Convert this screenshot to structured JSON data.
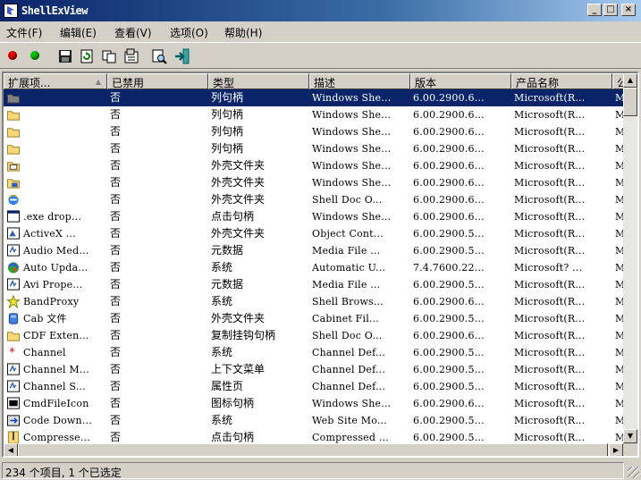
{
  "window": {
    "title": "ShellExView"
  },
  "titlebar_buttons": {
    "minimize": "_",
    "maximize": "□",
    "close": "×"
  },
  "menu": [
    "文件(F)",
    "编辑(E)",
    "查看(V)",
    "选项(O)",
    "帮助(H)"
  ],
  "toolbar_icons": [
    "red-dot-icon",
    "green-dot-icon",
    "save-icon",
    "refresh-icon",
    "copy-icon",
    "properties-icon",
    "find-icon",
    "exit-icon"
  ],
  "colors": {
    "selected": "#0a246a",
    "title_start": "#0a246a",
    "red_dot": "#e00000",
    "green_dot": "#00c000"
  },
  "columns": [
    "扩展项...",
    "已禁用",
    "类型",
    "描述",
    "版本",
    "产品名称",
    "公"
  ],
  "rows": [
    {
      "icon": "folder-gray-icon",
      "name": "",
      "disabled": "否",
      "type": "列句柄",
      "desc": "Windows She...",
      "version": "6.00.2900.6...",
      "product": "Microsoft(R...",
      "company": "M:",
      "selected": true
    },
    {
      "icon": "folder-icon",
      "name": "",
      "disabled": "否",
      "type": "列句柄",
      "desc": "Windows She...",
      "version": "6.00.2900.6...",
      "product": "Microsoft(R...",
      "company": "M:"
    },
    {
      "icon": "folder-icon",
      "name": "",
      "disabled": "否",
      "type": "列句柄",
      "desc": "Windows She...",
      "version": "6.00.2900.6...",
      "product": "Microsoft(R...",
      "company": "M:"
    },
    {
      "icon": "folder-icon",
      "name": "",
      "disabled": "否",
      "type": "列句柄",
      "desc": "Windows She...",
      "version": "6.00.2900.6...",
      "product": "Microsoft(R...",
      "company": "M:"
    },
    {
      "icon": "printer-folder-icon",
      "name": "",
      "disabled": "否",
      "type": "外壳文件夹",
      "desc": "Windows She...",
      "version": "6.00.2900.6...",
      "product": "Microsoft(R...",
      "company": "M:"
    },
    {
      "icon": "network-folder-icon",
      "name": "",
      "disabled": "否",
      "type": "外壳文件夹",
      "desc": "Windows She...",
      "version": "6.00.2900.6...",
      "product": "Microsoft(R...",
      "company": "M:"
    },
    {
      "icon": "ie-icon",
      "name": "",
      "disabled": "否",
      "type": "外壳文件夹",
      "desc": "Shell Doc O...",
      "version": "6.00.2900.6...",
      "product": "Microsoft(R...",
      "company": "M:"
    },
    {
      "icon": "exe-icon",
      "name": ".exe drop...",
      "disabled": "否",
      "type": "点击句柄",
      "desc": "Windows She...",
      "version": "6.00.2900.6...",
      "product": "Microsoft(R...",
      "company": "M:"
    },
    {
      "icon": "activex-icon",
      "name": "ActiveX ...",
      "disabled": "否",
      "type": "外壳文件夹",
      "desc": "Object Cont...",
      "version": "6.00.2900.5...",
      "product": "Microsoft(R...",
      "company": "M:"
    },
    {
      "icon": "media-icon",
      "name": "Audio Med...",
      "disabled": "否",
      "type": "元数据",
      "desc": "Media File ...",
      "version": "6.00.2900.5...",
      "product": "Microsoft(R...",
      "company": "M:"
    },
    {
      "icon": "update-icon",
      "name": "Auto Upda...",
      "disabled": "否",
      "type": "系统",
      "desc": "Automatic U...",
      "version": "7.4.7600.22...",
      "product": "Microsoft? ...",
      "company": "M:"
    },
    {
      "icon": "media-icon",
      "name": "Avi Prope...",
      "disabled": "否",
      "type": "元数据",
      "desc": "Media File ...",
      "version": "6.00.2900.5...",
      "product": "Microsoft(R...",
      "company": "M:"
    },
    {
      "icon": "star-icon",
      "name": "BandProxy",
      "disabled": "否",
      "type": "系统",
      "desc": "Shell Brows...",
      "version": "6.00.2900.6...",
      "product": "Microsoft(R...",
      "company": "M:"
    },
    {
      "icon": "cab-icon",
      "name": "Cab 文件",
      "disabled": "否",
      "type": "外壳文件夹",
      "desc": "Cabinet Fil...",
      "version": "6.00.2900.5...",
      "product": "Microsoft(R...",
      "company": "M:"
    },
    {
      "icon": "folder-icon",
      "name": "CDF Exten...",
      "disabled": "否",
      "type": "复制挂钩句柄",
      "desc": "Shell Doc O...",
      "version": "6.00.2900.6...",
      "product": "Microsoft(R...",
      "company": "M:"
    },
    {
      "icon": "asterisk-icon",
      "name": "Channel",
      "disabled": "否",
      "type": "系统",
      "desc": "Channel Def...",
      "version": "6.00.2900.5...",
      "product": "Microsoft(R...",
      "company": "M:"
    },
    {
      "icon": "media-icon",
      "name": "Channel M...",
      "disabled": "否",
      "type": "上下文菜单",
      "desc": "Channel Def...",
      "version": "6.00.2900.5...",
      "product": "Microsoft(R...",
      "company": "M:"
    },
    {
      "icon": "media-icon",
      "name": "Channel S...",
      "disabled": "否",
      "type": "属性页",
      "desc": "Channel Def...",
      "version": "6.00.2900.5...",
      "product": "Microsoft(R...",
      "company": "M:"
    },
    {
      "icon": "cmd-icon",
      "name": "CmdFileIcon",
      "disabled": "否",
      "type": "图标句柄",
      "desc": "Windows She...",
      "version": "6.00.2900.6...",
      "product": "Microsoft(R...",
      "company": "M:"
    },
    {
      "icon": "download-icon",
      "name": "Code Down...",
      "disabled": "否",
      "type": "系统",
      "desc": "Web Site Mo...",
      "version": "6.00.2900.5...",
      "product": "Microsoft(R...",
      "company": "M:"
    },
    {
      "icon": "zip-icon",
      "name": "Compresse...",
      "disabled": "否",
      "type": "点击句柄",
      "desc": "Compressed ...",
      "version": "6.00.2900.5...",
      "product": "Microsoft(R...",
      "company": "M:"
    }
  ],
  "status": {
    "text": "234 个项目, 1 个已选定"
  }
}
